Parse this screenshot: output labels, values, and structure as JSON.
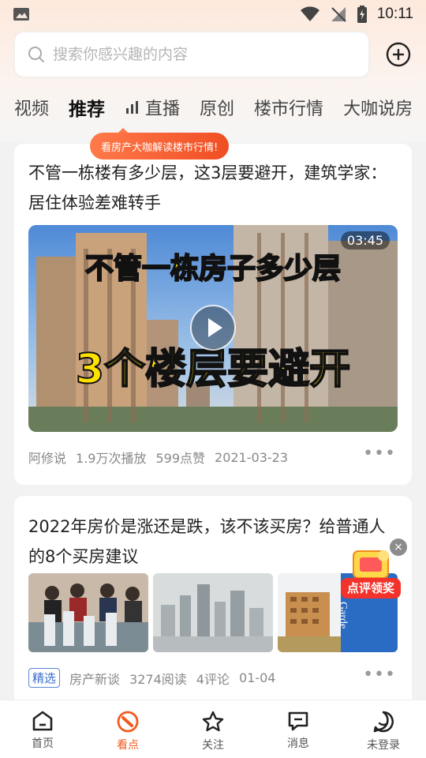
{
  "status_bar": {
    "time": "10:11"
  },
  "search": {
    "placeholder": "搜索你感兴趣的内容"
  },
  "tabs": [
    {
      "label": "视频"
    },
    {
      "label": "推荐"
    },
    {
      "label": "直播"
    },
    {
      "label": "原创"
    },
    {
      "label": "楼市行情"
    },
    {
      "label": "大咖说房"
    }
  ],
  "tooltip": "看房产大咖解读楼市行情!",
  "card1": {
    "title": "不管一栋楼有多少层，这3层要避开，建筑学家：居住体验差难转手",
    "video_overlay_line1": "不管一栋房子多少层",
    "video_overlay_line2": "3个楼层要避开",
    "duration": "03:45",
    "author": "阿修说",
    "plays": "1.9万次播放",
    "likes": "599点赞",
    "date": "2021-03-23"
  },
  "card2": {
    "title": "2022年房价是涨还是跌，该不该买房？给普通人的8个买房建议",
    "tag": "精选",
    "source": "房产新谈",
    "reads": "3274阅读",
    "comments": "4评论",
    "date": "01-04",
    "thumb3_text": "Garde"
  },
  "float_ad": {
    "label": "点评领奖",
    "close": "×"
  },
  "bottom_nav": [
    {
      "label": "首页",
      "icon": "home-icon"
    },
    {
      "label": "看点",
      "icon": "compass-icon"
    },
    {
      "label": "关注",
      "icon": "star-icon"
    },
    {
      "label": "消息",
      "icon": "message-icon"
    },
    {
      "label": "未登录",
      "icon": "profile-icon"
    }
  ],
  "colors": {
    "accent": "#f25a1f",
    "tag_blue": "#3b6bd0"
  }
}
